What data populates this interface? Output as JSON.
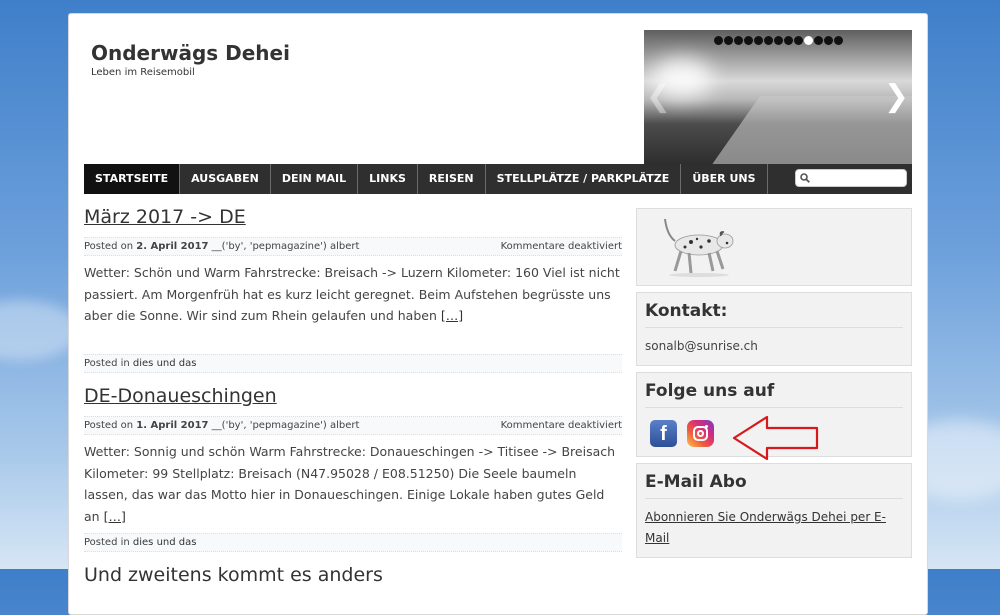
{
  "site": {
    "title": "Onderwägs Dehei",
    "tagline": "Leben im Reisemobil"
  },
  "slider": {
    "dots": 13,
    "active_dot": 9,
    "prev_icon": "chevron-left-icon",
    "next_icon": "chevron-right-icon"
  },
  "nav": {
    "items": [
      "STARTSEITE",
      "AUSGABEN",
      "DEIN MAIL",
      "LINKS",
      "REISEN",
      "STELLPLÄTZE / PARKPLÄTZE",
      "ÜBER UNS"
    ],
    "active_index": 0,
    "search_placeholder": ""
  },
  "posts": [
    {
      "title": "März 2017 -> DE",
      "meta_prefix": "Posted on ",
      "date": "2. April 2017",
      "author": " __('by', 'pepmagazine') albert",
      "comments": "Kommentare deaktiviert",
      "excerpt": "Wetter: Schön und Warm Fahrstrecke:  Breisach -> Luzern Kilometer: 160 Viel ist nicht passiert. Am Morgenfrüh hat es kurz leicht geregnet. Beim Aufstehen begrüsste uns aber die Sonne. Wir sind zum Rhein gelaufen und haben",
      "more": "[…]",
      "cat_prefix": "Posted in ",
      "category": "dies und das"
    },
    {
      "title": "DE-Donaueschingen",
      "meta_prefix": "Posted on ",
      "date": "1. April 2017",
      "author": " __('by', 'pepmagazine') albert",
      "comments": "Kommentare deaktiviert",
      "excerpt": "Wetter: Sonnig und schön Warm Fahrstrecke:  Donaueschingen -> Titisee -> Breisach Kilometer: 99 Stellplatz:  Breisach (N47.95028 / E08.51250) Die Seele baumeln lassen, das war das Motto hier in Donaueschingen. Einige Lokale haben gutes Geld an",
      "more": "[…]",
      "cat_prefix": "Posted in ",
      "category": "dies und das"
    },
    {
      "title": "Und zweitens kommt es anders"
    }
  ],
  "sidebar": {
    "kontakt_title": "Kontakt:",
    "kontakt_email": "sonalb@sunrise.ch",
    "folge_title": "Folge uns auf",
    "social_icons": [
      "facebook-icon",
      "instagram-icon"
    ],
    "arrow_color": "#d6191c",
    "email_title": "E-Mail Abo",
    "email_link": "Abonnieren Sie Onderwägs Dehei per E-Mail"
  },
  "colors": {
    "nav_bg": "#2f2f2f",
    "nav_active": "#111111",
    "widget_bg": "#f2f2f2"
  }
}
